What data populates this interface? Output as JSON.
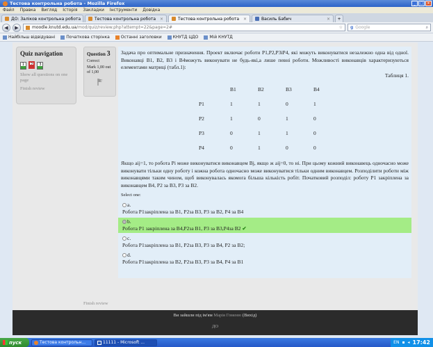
{
  "window": {
    "title": "Тестова контрольна робота - Mozilla Firefox",
    "min": "_",
    "max": "□",
    "close": "×"
  },
  "menu": [
    "Файл",
    "Правка",
    "Вигляд",
    "Історія",
    "Закладки",
    "Інструменти",
    "Довідка"
  ],
  "tabs": [
    {
      "label": "ДО: Заліков контрольна робота",
      "active": false
    },
    {
      "label": "Тестова контрольна робота",
      "active": false
    },
    {
      "label": "Тестова контрольна робота",
      "active": true
    },
    {
      "label": "Василь Бабич",
      "active": false
    }
  ],
  "nav": {
    "back": "◀",
    "forward": "▶",
    "url_host": "moodle.knutd.edu.ua",
    "url_path": "/mod/quiz/review.php?attempt=22&page=2#",
    "search_placeholder": "Google",
    "search_icon": "search-icon"
  },
  "bookmarks": [
    "Найбільш відвідувані",
    "Початкова сторінка",
    "Останні заголовки",
    "КНУТД ЦДО",
    "Мій КНУТД"
  ],
  "quiz_nav": {
    "title": "Quiz navigation",
    "buttons": [
      "1",
      "2",
      "3"
    ],
    "show_all": "Show all questions on one page",
    "finish": "Finish review"
  },
  "question_info": {
    "label": "Question",
    "number": "3",
    "state": "Correct",
    "mark": "Mark 1,00 out of 1,00",
    "flag_icon": "flag-icon"
  },
  "question": {
    "para1": "Задача про оптимальне призначення. Проект включає роботи P1,P2,P3iP4, які можуть виконуватися незалежно одна від одної. Виконавці B1, B2, B3 і B4можуть виконувати не будь-які,а лише певні роботи. Можливості виконавців характеризуються елементами матриці (табл.1):",
    "table_caption": "Таблиця 1.",
    "matrix": {
      "headers": [
        "",
        "B1",
        "B2",
        "B3",
        "B4"
      ],
      "rows": [
        [
          "P1",
          "1",
          "1",
          "0",
          "1"
        ],
        [
          "P2",
          "1",
          "0",
          "1",
          "0"
        ],
        [
          "P3",
          "0",
          "1",
          "1",
          "0"
        ],
        [
          "P4",
          "0",
          "1",
          "0",
          "0"
        ]
      ]
    },
    "para2": "Якщо aij=1, то робота Pi може виконуватися виконавцем Bj, якщо ж aij=0, то ні. При цьому кожний виконавець одночасно може виконувати тільки одну роботу і кожна робота одночасно може виконуватися тільки одним виконавцем. Розподілити роботи між виконавцями таким чином, щоб виконувалась якомога більша кількість робіт. Початковий розподіл: роботу P1 закріплена за виконавцем B4, P2 за B3, P3 за B2.",
    "select_one": "Select one:",
    "answers": [
      {
        "letter": "a.",
        "text": "Робота P1закріплена за B1, P2за B3, P3 за B2, P4 за B4",
        "correct": false
      },
      {
        "letter": "b.",
        "text": "Робота P1 закріплена за B4,P2за B1, P3 за B3,P4за B2",
        "correct": true
      },
      {
        "letter": "c.",
        "text": "Робота P1закріплена за B1, P2за B3, P3 за B4, P2 за B2;",
        "correct": false
      },
      {
        "letter": "d.",
        "text": "Робота P1закріплена за B2, P2за B3, P3 за B4, P4 за B1",
        "correct": false
      }
    ],
    "check_mark": "✔"
  },
  "finish_review": "Finish review",
  "footer": {
    "logged_in": "Ви зайшли під ім'ям",
    "user": "Марія Гоменю",
    "logout": "(Вихід)",
    "home": "ДО"
  },
  "taskbar": {
    "start": "пуск",
    "tasks": [
      "Тестова контрольн...",
      "11111 - Microsoft ..."
    ],
    "lang": "EN",
    "clock": "17:42"
  }
}
